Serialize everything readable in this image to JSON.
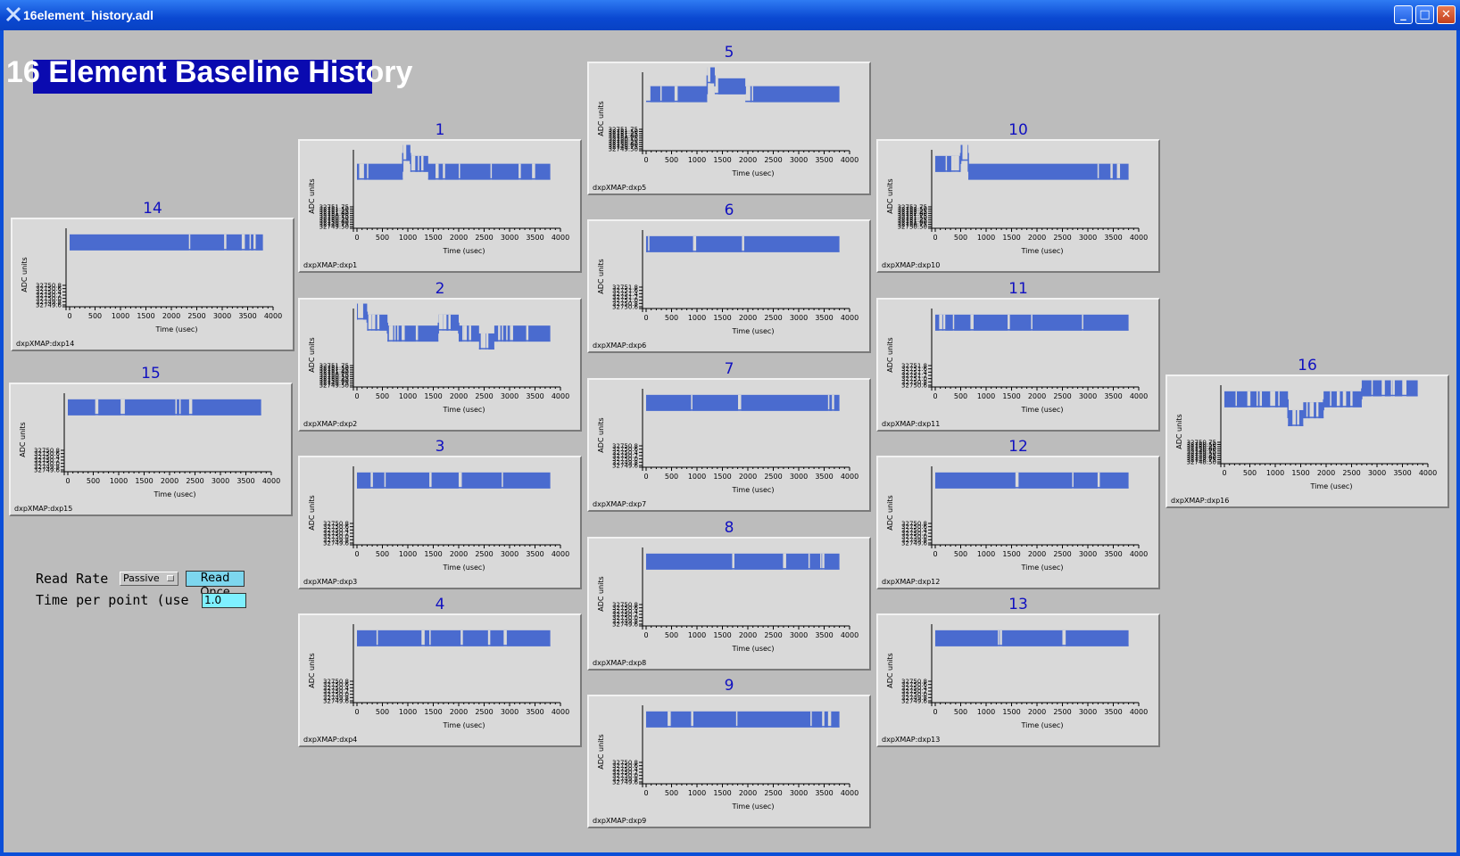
{
  "window": {
    "title": "16element_history.adl",
    "minimize": "_",
    "maximize": "□",
    "close": "✕"
  },
  "colors": {
    "trace": "#4a6bcf",
    "plot_bg": "#d9d9d9",
    "client_bg": "#bcbcbc",
    "title_color": "#1010c0"
  },
  "page": {
    "title": "16 Element Baseline History"
  },
  "controls": {
    "read_rate_label": "Read Rate",
    "read_rate_value": "Passive",
    "read_once_label": "Read Once",
    "time_per_point_label": "Time per point (use",
    "time_per_point_value": "1.0"
  },
  "plots": [
    {
      "id": "1",
      "name": "dxpXMAP:dxp1",
      "ylabel": "ADC units",
      "xlabel": "Time (usec)",
      "yticks": [
        "32751.75",
        "32751.50",
        "32751.25",
        "32751.00",
        "32750.75",
        "32750.50",
        "32750.25",
        "32750.00",
        "32749.75",
        "32749.50"
      ],
      "xticks": [
        "0",
        "500",
        "1000",
        "1500",
        "2000",
        "2500",
        "3000",
        "3500",
        "4000"
      ]
    },
    {
      "id": "2",
      "name": "dxpXMAP:dxp2",
      "ylabel": "ADC units",
      "xlabel": "Time (usec)",
      "yticks": [
        "32751.75",
        "32751.50",
        "32751.25",
        "32751.00",
        "32750.75",
        "32750.50",
        "32750.25",
        "32750.00",
        "32749.75",
        "32749.50"
      ],
      "xticks": [
        "0",
        "500",
        "1000",
        "1500",
        "2000",
        "2500",
        "3000",
        "3500",
        "4000"
      ]
    },
    {
      "id": "3",
      "name": "dxpXMAP:dxp3",
      "ylabel": "ADC units",
      "xlabel": "Time (usec)",
      "yticks": [
        "32750.8",
        "32750.6",
        "32750.4",
        "32750.2",
        "32750.0",
        "32749.8",
        "32749.6"
      ],
      "xticks": [
        "0",
        "500",
        "1000",
        "1500",
        "2000",
        "2500",
        "3000",
        "3500",
        "4000"
      ]
    },
    {
      "id": "4",
      "name": "dxpXMAP:dxp4",
      "ylabel": "ADC units",
      "xlabel": "Time (usec)",
      "yticks": [
        "32750.8",
        "32750.6",
        "32750.4",
        "32750.2",
        "32750.0",
        "32749.8",
        "32749.6"
      ],
      "xticks": [
        "0",
        "500",
        "1000",
        "1500",
        "2000",
        "2500",
        "3000",
        "3500",
        "4000"
      ]
    },
    {
      "id": "5",
      "name": "dxpXMAP:dxp5",
      "ylabel": "ADC units",
      "xlabel": "Time (usec)",
      "yticks": [
        "32751.75",
        "32751.50",
        "32751.25",
        "32751.00",
        "32750.75",
        "32750.50",
        "32750.25",
        "32750.00",
        "32749.75",
        "32749.50"
      ],
      "xticks": [
        "0",
        "500",
        "1000",
        "1500",
        "2000",
        "2500",
        "3000",
        "3500",
        "4000"
      ]
    },
    {
      "id": "6",
      "name": "dxpXMAP:dxp6",
      "ylabel": "ADC units",
      "xlabel": "Time (usec)",
      "yticks": [
        "32751.8",
        "32751.6",
        "32751.4",
        "32751.2",
        "32751.0",
        "32750.8",
        "32750.6"
      ],
      "xticks": [
        "0",
        "500",
        "1000",
        "1500",
        "2000",
        "2500",
        "3000",
        "3500",
        "4000"
      ]
    },
    {
      "id": "7",
      "name": "dxpXMAP:dxp7",
      "ylabel": "ADC units",
      "xlabel": "Time (usec)",
      "yticks": [
        "32750.8",
        "32750.6",
        "32750.4",
        "32750.2",
        "32750.0",
        "32749.8",
        "32749.6"
      ],
      "xticks": [
        "0",
        "500",
        "1000",
        "1500",
        "2000",
        "2500",
        "3000",
        "3500",
        "4000"
      ]
    },
    {
      "id": "8",
      "name": "dxpXMAP:dxp8",
      "ylabel": "ADC units",
      "xlabel": "Time (usec)",
      "yticks": [
        "32750.8",
        "32750.6",
        "32750.4",
        "32750.2",
        "32750.0",
        "32749.8",
        "32749.6"
      ],
      "xticks": [
        "0",
        "500",
        "1000",
        "1500",
        "2000",
        "2500",
        "3000",
        "3500",
        "4000"
      ]
    },
    {
      "id": "9",
      "name": "dxpXMAP:dxp9",
      "ylabel": "ADC units",
      "xlabel": "Time (usec)",
      "yticks": [
        "32750.8",
        "32750.6",
        "32750.4",
        "32750.2",
        "32750.0",
        "32749.8",
        "32749.6"
      ],
      "xticks": [
        "0",
        "500",
        "1000",
        "1500",
        "2000",
        "2500",
        "3000",
        "3500",
        "4000"
      ]
    },
    {
      "id": "10",
      "name": "dxpXMAP:dxp10",
      "ylabel": "ADC units",
      "xlabel": "Time (usec)",
      "yticks": [
        "32752.75",
        "32752.50",
        "32752.25",
        "32752.00",
        "32751.75",
        "32751.50",
        "32751.25",
        "32751.00",
        "32750.75",
        "32750.50"
      ],
      "xticks": [
        "0",
        "500",
        "1000",
        "1500",
        "2000",
        "2500",
        "3000",
        "3500",
        "4000"
      ]
    },
    {
      "id": "11",
      "name": "dxpXMAP:dxp11",
      "ylabel": "ADC units",
      "xlabel": "Time (usec)",
      "yticks": [
        "32751.8",
        "32751.6",
        "32751.4",
        "32751.2",
        "32751.0",
        "32750.8",
        "32750.6"
      ],
      "xticks": [
        "0",
        "500",
        "1000",
        "1500",
        "2000",
        "2500",
        "3000",
        "3500",
        "4000"
      ]
    },
    {
      "id": "12",
      "name": "dxpXMAP:dxp12",
      "ylabel": "ADC units",
      "xlabel": "Time (usec)",
      "yticks": [
        "32750.8",
        "32750.6",
        "32750.4",
        "32750.2",
        "32750.0",
        "32749.8",
        "32749.6"
      ],
      "xticks": [
        "0",
        "500",
        "1000",
        "1500",
        "2000",
        "2500",
        "3000",
        "3500",
        "4000"
      ]
    },
    {
      "id": "13",
      "name": "dxpXMAP:dxp13",
      "ylabel": "ADC units",
      "xlabel": "Time (usec)",
      "yticks": [
        "32750.8",
        "32750.6",
        "32750.4",
        "32750.2",
        "32750.0",
        "32749.8",
        "32749.6"
      ],
      "xticks": [
        "0",
        "500",
        "1000",
        "1500",
        "2000",
        "2500",
        "3000",
        "3500",
        "4000"
      ]
    },
    {
      "id": "14",
      "name": "dxpXMAP:dxp14",
      "ylabel": "ADC units",
      "xlabel": "Time (usec)",
      "yticks": [
        "32750.8",
        "32750.6",
        "32750.4",
        "32750.2",
        "32750.0",
        "32749.8",
        "32749.6"
      ],
      "xticks": [
        "0",
        "500",
        "1000",
        "1500",
        "2000",
        "2500",
        "3000",
        "3500",
        "4000"
      ]
    },
    {
      "id": "15",
      "name": "dxpXMAP:dxp15",
      "ylabel": "ADC units",
      "xlabel": "Time (usec)",
      "yticks": [
        "32750.8",
        "32750.6",
        "32750.4",
        "32750.2",
        "32750.0",
        "32749.8",
        "32749.6"
      ],
      "xticks": [
        "0",
        "500",
        "1000",
        "1500",
        "2000",
        "2500",
        "3000",
        "3500",
        "4000"
      ]
    },
    {
      "id": "16",
      "name": "dxpXMAP:dxp16",
      "ylabel": "ADC units",
      "xlabel": "Time (usec)",
      "yticks": [
        "32750.75",
        "32750.50",
        "32750.25",
        "32750.00",
        "32749.75",
        "32749.50",
        "32749.25",
        "32749.00",
        "32748.75",
        "32748.50"
      ],
      "xticks": [
        "0",
        "500",
        "1000",
        "1500",
        "2000",
        "2500",
        "3000",
        "3500",
        "4000"
      ]
    }
  ],
  "chart_data": [
    {
      "type": "line",
      "id": "1",
      "x_range": [
        0,
        4000
      ],
      "segments": [
        [
          0,
          900,
          0.72
        ],
        [
          900,
          1050,
          0.96
        ],
        [
          1050,
          1400,
          0.82
        ],
        [
          1400,
          3800,
          0.72
        ]
      ]
    },
    {
      "type": "line",
      "id": "2",
      "x_range": [
        0,
        4000
      ],
      "segments": [
        [
          0,
          200,
          0.96
        ],
        [
          200,
          600,
          0.82
        ],
        [
          600,
          1600,
          0.68
        ],
        [
          1600,
          2000,
          0.82
        ],
        [
          2000,
          2400,
          0.68
        ],
        [
          2400,
          2700,
          0.58
        ],
        [
          2700,
          3800,
          0.68
        ]
      ]
    },
    {
      "type": "line",
      "id": "3",
      "x_range": [
        0,
        4000
      ],
      "segments": [
        [
          0,
          3800,
          0.82
        ]
      ]
    },
    {
      "type": "line",
      "id": "4",
      "x_range": [
        0,
        4000
      ],
      "segments": [
        [
          0,
          3800,
          0.82
        ]
      ]
    },
    {
      "type": "line",
      "id": "5",
      "x_range": [
        0,
        4000
      ],
      "segments": [
        [
          0,
          1200,
          0.72
        ],
        [
          1200,
          1350,
          0.96
        ],
        [
          1350,
          1950,
          0.82
        ],
        [
          1950,
          3800,
          0.72
        ]
      ]
    },
    {
      "type": "line",
      "id": "6",
      "x_range": [
        0,
        4000
      ],
      "segments": [
        [
          0,
          3800,
          0.82
        ]
      ]
    },
    {
      "type": "line",
      "id": "7",
      "x_range": [
        0,
        4000
      ],
      "segments": [
        [
          0,
          3800,
          0.82
        ]
      ]
    },
    {
      "type": "line",
      "id": "8",
      "x_range": [
        0,
        4000
      ],
      "segments": [
        [
          0,
          3800,
          0.82
        ]
      ]
    },
    {
      "type": "line",
      "id": "9",
      "x_range": [
        0,
        4000
      ],
      "segments": [
        [
          0,
          3800,
          0.82
        ]
      ]
    },
    {
      "type": "line",
      "id": "10",
      "x_range": [
        0,
        4000
      ],
      "segments": [
        [
          0,
          500,
          0.82
        ],
        [
          500,
          650,
          0.96
        ],
        [
          650,
          3800,
          0.72
        ]
      ]
    },
    {
      "type": "line",
      "id": "11",
      "x_range": [
        0,
        4000
      ],
      "segments": [
        [
          0,
          3800,
          0.82
        ]
      ]
    },
    {
      "type": "line",
      "id": "12",
      "x_range": [
        0,
        4000
      ],
      "segments": [
        [
          0,
          3800,
          0.82
        ]
      ]
    },
    {
      "type": "line",
      "id": "13",
      "x_range": [
        0,
        4000
      ],
      "segments": [
        [
          0,
          3800,
          0.82
        ]
      ]
    },
    {
      "type": "line",
      "id": "14",
      "x_range": [
        0,
        4000
      ],
      "segments": [
        [
          0,
          3800,
          0.82
        ]
      ]
    },
    {
      "type": "line",
      "id": "15",
      "x_range": [
        0,
        4000
      ],
      "segments": [
        [
          0,
          3800,
          0.82
        ]
      ]
    },
    {
      "type": "line",
      "id": "16",
      "x_range": [
        0,
        4000
      ],
      "segments": [
        [
          0,
          1250,
          0.82
        ],
        [
          1250,
          1550,
          0.58
        ],
        [
          1550,
          1950,
          0.68
        ],
        [
          1950,
          2700,
          0.82
        ],
        [
          2700,
          3800,
          0.96
        ]
      ]
    }
  ]
}
